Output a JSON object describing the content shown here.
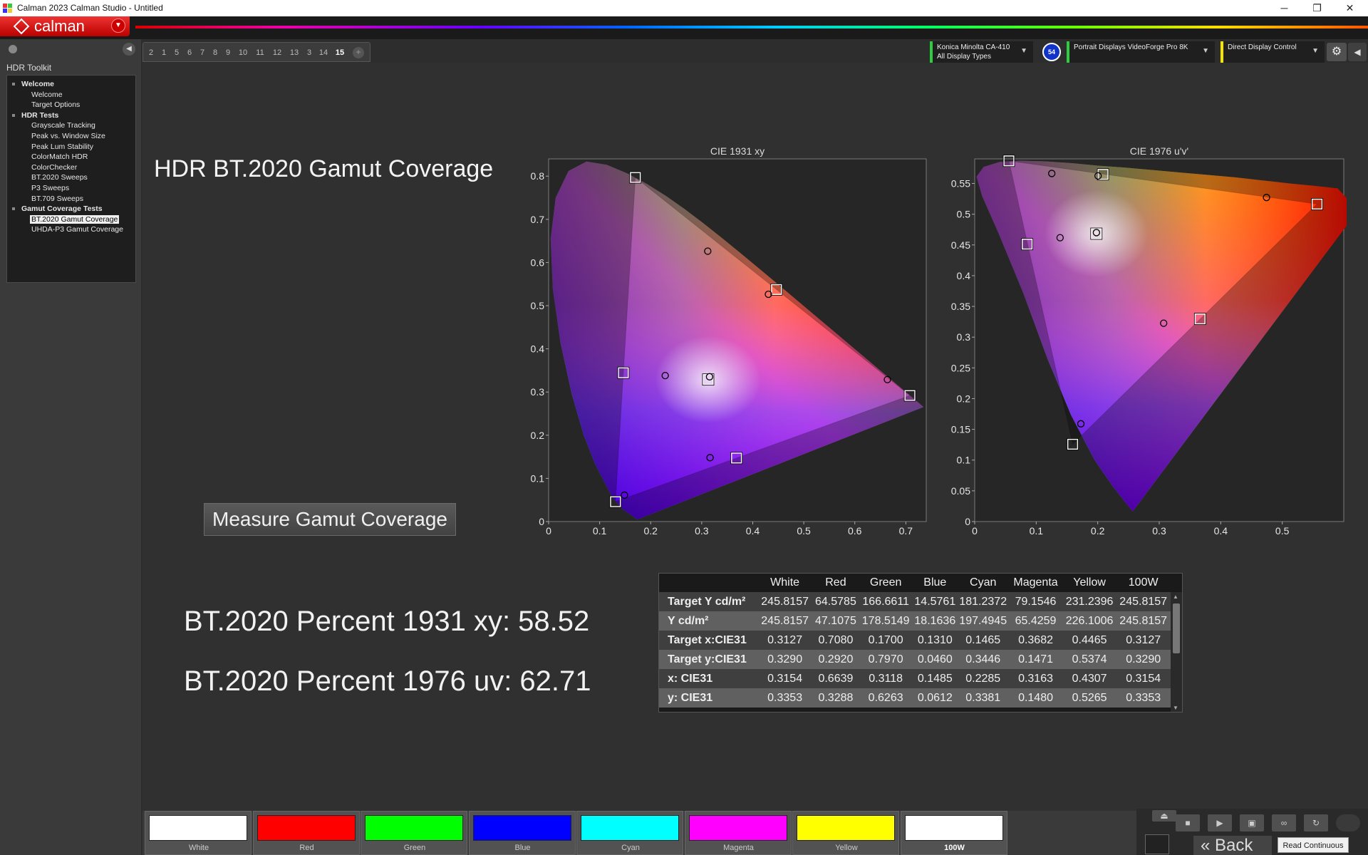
{
  "window": {
    "title": "Calman 2023 Calman Studio  - Untitled",
    "minimize": "─",
    "maximize": "❐",
    "close": "✕"
  },
  "brand": {
    "logo_text": "calman"
  },
  "left_panel": {
    "heading": "HDR Toolkit",
    "tree": [
      {
        "type": "group",
        "label": "Welcome"
      },
      {
        "type": "item",
        "label": "Welcome"
      },
      {
        "type": "item",
        "label": "Target Options"
      },
      {
        "type": "group",
        "label": "HDR Tests"
      },
      {
        "type": "item",
        "label": "Grayscale Tracking"
      },
      {
        "type": "item",
        "label": "Peak vs. Window Size"
      },
      {
        "type": "item",
        "label": "Peak Lum Stability"
      },
      {
        "type": "item",
        "label": "ColorMatch HDR"
      },
      {
        "type": "item",
        "label": "ColorChecker"
      },
      {
        "type": "item",
        "label": "BT.2020 Sweeps"
      },
      {
        "type": "item",
        "label": "P3 Sweeps"
      },
      {
        "type": "item",
        "label": "BT.709 Sweeps"
      },
      {
        "type": "group",
        "label": "Gamut Coverage Tests"
      },
      {
        "type": "item",
        "label": "BT.2020 Gamut Coverage",
        "selected": true
      },
      {
        "type": "item",
        "label": "UHDA-P3 Gamut Coverage"
      }
    ]
  },
  "tabs": [
    "2",
    "1",
    "5",
    "6",
    "7",
    "8",
    "9",
    "10",
    "11",
    "12",
    "13",
    "3",
    "14",
    "15"
  ],
  "active_tab": "15",
  "tab_add": "+",
  "devices": {
    "meter": {
      "line1": "Konica Minolta CA-410",
      "line2": "All Display Types",
      "color": "#2ecc40"
    },
    "badge": "54",
    "source": {
      "line1": "Portrait Displays VideoForge Pro 8K",
      "color": "#2ecc40"
    },
    "display": {
      "line1": "Direct Display Control",
      "color": "#f5e400"
    }
  },
  "main": {
    "title": "HDR BT.2020  Gamut Coverage",
    "measure_button": "Measure Gamut Coverage",
    "pct_1931": "BT.2020 Percent 1931 xy: 58.52",
    "pct_1976": "BT.2020 Percent 1976 uv: 62.71"
  },
  "chart_data": [
    {
      "type": "scatter",
      "title": "CIE 1931 xy",
      "xlim": [
        0,
        0.74
      ],
      "ylim": [
        0,
        0.84
      ],
      "x_ticks": [
        "0",
        "0.1",
        "0.2",
        "0.3",
        "0.4",
        "0.5",
        "0.6",
        "0.7"
      ],
      "y_ticks": [
        "0",
        "0.1",
        "0.2",
        "0.3",
        "0.4",
        "0.5",
        "0.6",
        "0.7",
        "0.8"
      ],
      "targets": [
        {
          "name": "Red",
          "x": 0.708,
          "y": 0.292
        },
        {
          "name": "Green",
          "x": 0.17,
          "y": 0.797
        },
        {
          "name": "Blue",
          "x": 0.131,
          "y": 0.046
        },
        {
          "name": "Cyan",
          "x": 0.1465,
          "y": 0.3446
        },
        {
          "name": "Magenta",
          "x": 0.3682,
          "y": 0.1471
        },
        {
          "name": "Yellow",
          "x": 0.4465,
          "y": 0.5374
        },
        {
          "name": "White",
          "x": 0.3127,
          "y": 0.329
        }
      ],
      "measured": [
        {
          "name": "Red",
          "x": 0.6639,
          "y": 0.3288
        },
        {
          "name": "Green",
          "x": 0.3118,
          "y": 0.6263
        },
        {
          "name": "Blue",
          "x": 0.1485,
          "y": 0.0612
        },
        {
          "name": "Cyan",
          "x": 0.2285,
          "y": 0.3381
        },
        {
          "name": "Magenta",
          "x": 0.3163,
          "y": 0.148
        },
        {
          "name": "Yellow",
          "x": 0.4307,
          "y": 0.5265
        },
        {
          "name": "White",
          "x": 0.3154,
          "y": 0.3353
        }
      ]
    },
    {
      "type": "scatter",
      "title": "CIE 1976 u'v'",
      "xlim": [
        0,
        0.6
      ],
      "ylim": [
        0,
        0.59
      ],
      "x_ticks": [
        "0",
        "0.1",
        "0.2",
        "0.3",
        "0.4",
        "0.5"
      ],
      "y_ticks": [
        "0",
        "0.05",
        "0.1",
        "0.15",
        "0.2",
        "0.25",
        "0.3",
        "0.35",
        "0.4",
        "0.45",
        "0.5",
        "0.55"
      ],
      "targets": [
        {
          "name": "Red",
          "x": 0.5566,
          "y": 0.5165
        },
        {
          "name": "Green",
          "x": 0.0556,
          "y": 0.5868
        },
        {
          "name": "Blue",
          "x": 0.1593,
          "y": 0.1258
        },
        {
          "name": "Cyan",
          "x": 0.0853,
          "y": 0.4513
        },
        {
          "name": "Magenta",
          "x": 0.3664,
          "y": 0.3297
        },
        {
          "name": "Yellow",
          "x": 0.2086,
          "y": 0.5648
        },
        {
          "name": "White",
          "x": 0.1978,
          "y": 0.4683
        }
      ],
      "measured": [
        {
          "name": "Red",
          "x": 0.4744,
          "y": 0.5272
        },
        {
          "name": "Green",
          "x": 0.1253,
          "y": 0.5663
        },
        {
          "name": "Blue",
          "x": 0.1726,
          "y": 0.159
        },
        {
          "name": "Cyan",
          "x": 0.1388,
          "y": 0.4618
        },
        {
          "name": "Magenta",
          "x": 0.3072,
          "y": 0.3227
        },
        {
          "name": "Yellow",
          "x": 0.2006,
          "y": 0.5623
        },
        {
          "name": "White",
          "x": 0.1979,
          "y": 0.4701
        }
      ]
    }
  ],
  "table": {
    "columns": [
      "",
      "White",
      "Red",
      "Green",
      "Blue",
      "Cyan",
      "Magenta",
      "Yellow",
      "100W"
    ],
    "rows": [
      [
        "Target Y cd/m²",
        "245.8157",
        "64.5785",
        "166.6611",
        "14.5761",
        "181.2372",
        "79.1546",
        "231.2396",
        "245.8157"
      ],
      [
        "Y cd/m²",
        "245.8157",
        "47.1075",
        "178.5149",
        "18.1636",
        "197.4945",
        "65.4259",
        "226.1006",
        "245.8157"
      ],
      [
        "Target x:CIE31",
        "0.3127",
        "0.7080",
        "0.1700",
        "0.1310",
        "0.1465",
        "0.3682",
        "0.4465",
        "0.3127"
      ],
      [
        "Target y:CIE31",
        "0.3290",
        "0.2920",
        "0.7970",
        "0.0460",
        "0.3446",
        "0.1471",
        "0.5374",
        "0.3290"
      ],
      [
        "x: CIE31",
        "0.3154",
        "0.6639",
        "0.3118",
        "0.1485",
        "0.2285",
        "0.3163",
        "0.4307",
        "0.3154"
      ],
      [
        "y: CIE31",
        "0.3353",
        "0.3288",
        "0.6263",
        "0.0612",
        "0.3381",
        "0.1480",
        "0.5265",
        "0.3353"
      ]
    ]
  },
  "swatches": [
    {
      "label": "White",
      "color": "#ffffff"
    },
    {
      "label": "Red",
      "color": "#ff0000"
    },
    {
      "label": "Green",
      "color": "#00ff00"
    },
    {
      "label": "Blue",
      "color": "#0000ff"
    },
    {
      "label": "Cyan",
      "color": "#00ffff"
    },
    {
      "label": "Magenta",
      "color": "#ff00ff"
    },
    {
      "label": "Yellow",
      "color": "#ffff00"
    },
    {
      "label": "100W",
      "color": "#ffffff",
      "active": true
    }
  ],
  "controls": {
    "back_label": "Back",
    "read_continuous": "Read Continuous",
    "buttons": [
      "stop-icon",
      "play-icon",
      "save-icon",
      "infinity-icon",
      "refresh-icon"
    ]
  }
}
